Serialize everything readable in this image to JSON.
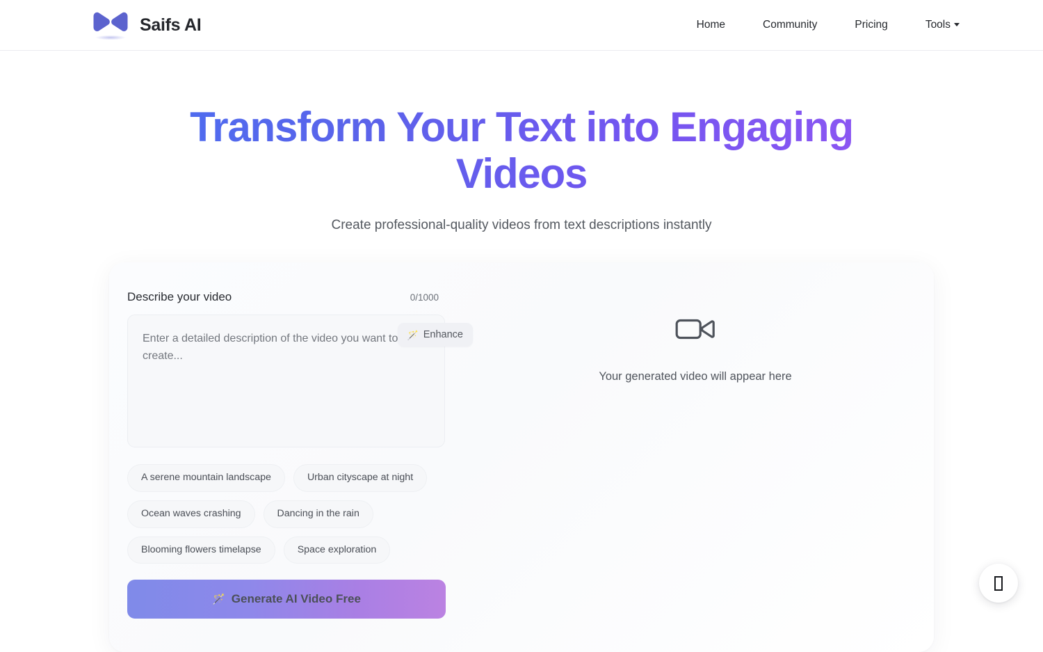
{
  "header": {
    "brand_name": "Saifs AI",
    "logo_icon": "bowtie-play-logo",
    "nav": [
      {
        "label": "Home",
        "has_caret": false
      },
      {
        "label": "Community",
        "has_caret": false
      },
      {
        "label": "Pricing",
        "has_caret": false
      },
      {
        "label": "Tools",
        "has_caret": true
      }
    ]
  },
  "hero": {
    "title": "Transform Your Text into Engaging Videos",
    "subtitle": "Create professional-quality videos from text descriptions instantly",
    "gradient_from": "#4c6ef0",
    "gradient_to": "#9157f3"
  },
  "editor": {
    "field_label": "Describe your video",
    "char_counter": "0/1000",
    "prompt_value": "",
    "prompt_placeholder": "Enter a detailed description of the video you want to create...",
    "enhance_label": "Enhance",
    "enhance_icon": "magic-wand-icon",
    "suggestions": [
      "A serene mountain landscape",
      "Urban cityscape at night",
      "Ocean waves crashing",
      "Dancing in the rain",
      "Blooming flowers timelapse",
      "Space exploration"
    ],
    "generate_label": "Generate AI Video Free",
    "generate_icon": "magic-wand-icon",
    "generate_gradient_from": "#7f8ae9",
    "generate_gradient_to": "#bb82e2"
  },
  "preview": {
    "icon": "video-camera-icon",
    "placeholder_text": "Your generated video will appear here"
  },
  "fab": {
    "icon": "missing-glyph-icon",
    "glyph": ""
  }
}
